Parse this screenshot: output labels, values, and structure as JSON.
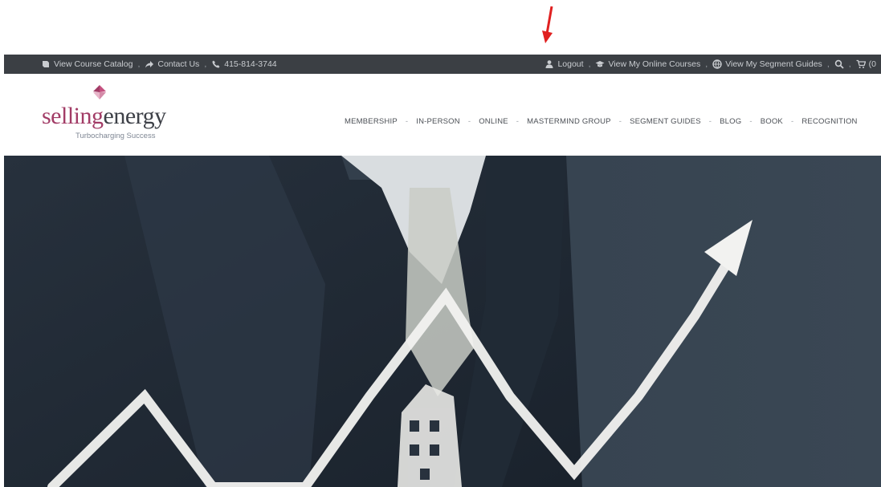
{
  "topbar": {
    "left_items": [
      {
        "icon": "book-icon",
        "label": "View Course Catalog"
      },
      {
        "icon": "share-arrow-icon",
        "label": "Contact Us"
      },
      {
        "icon": "phone-icon",
        "label": "415-814-3744"
      }
    ],
    "right_items": [
      {
        "icon": "user-icon",
        "label": "Logout"
      },
      {
        "icon": "graduation-cap-icon",
        "label": "View My Online Courses"
      },
      {
        "icon": "globe-icon",
        "label": "View My Segment Guides"
      }
    ],
    "cart_count": "(0"
  },
  "header": {
    "logo_part1": "selling",
    "logo_part2": "energy",
    "tagline": "Turbocharging Success"
  },
  "nav": {
    "items": [
      "MEMBERSHIP",
      "IN-PERSON",
      "ONLINE",
      "MASTERMIND GROUP",
      "SEGMENT GUIDES",
      "BLOG",
      "BOOK",
      "RECOGNITION"
    ]
  },
  "colors": {
    "accent": "#a23c66",
    "topbar_bg": "#3b3f44",
    "annotation_arrow": "#e02020"
  }
}
